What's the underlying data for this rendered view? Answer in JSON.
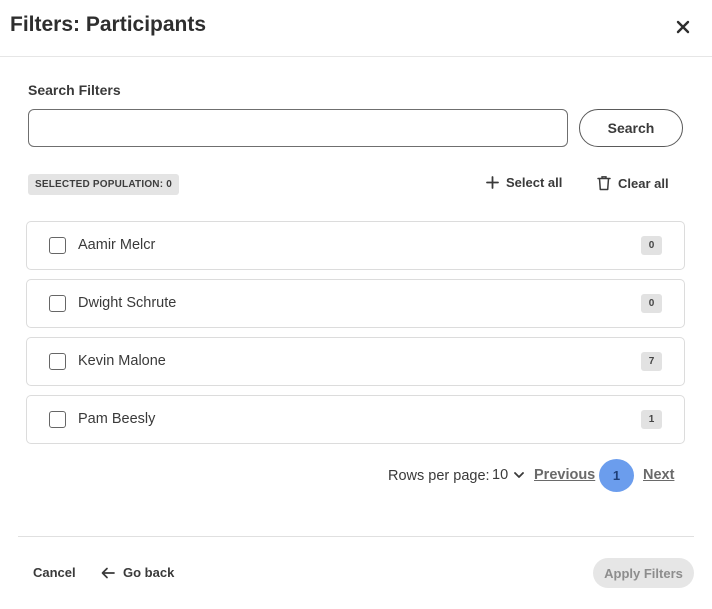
{
  "header": {
    "title": "Filters: Participants",
    "close_icon": "close-icon"
  },
  "search": {
    "label": "Search Filters",
    "value": "",
    "placeholder": "",
    "button_label": "Search"
  },
  "selection": {
    "badge": "SELECTED POPULATION: 0",
    "select_all_label": "Select all",
    "select_all_icon": "plus-icon",
    "clear_all_label": "Clear all",
    "clear_all_icon": "trash-icon"
  },
  "items": [
    {
      "name": "Aamir Melcr",
      "count": "0",
      "checked": false
    },
    {
      "name": "Dwight Schrute",
      "count": "0",
      "checked": false
    },
    {
      "name": "Kevin Malone",
      "count": "7",
      "checked": false
    },
    {
      "name": "Pam Beesly",
      "count": "1",
      "checked": false
    }
  ],
  "pagination": {
    "rows_label": "Rows per page:",
    "rows_value": "10",
    "previous_label": "Previous",
    "current_page": "1",
    "next_label": "Next"
  },
  "footer": {
    "cancel_label": "Cancel",
    "go_back_label": "Go back",
    "go_back_icon": "arrow-left-icon",
    "apply_label": "Apply Filters"
  },
  "colors": {
    "accent_page": "#6b9ded",
    "badge_bg": "#e4e4e4",
    "apply_disabled_bg": "#e6e6e6"
  }
}
